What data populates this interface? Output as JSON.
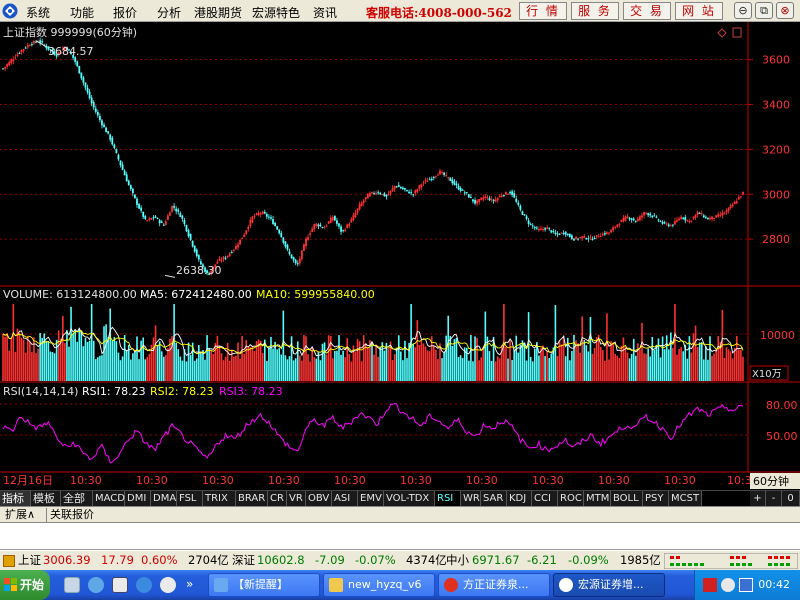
{
  "menu": {
    "items": [
      "系统",
      "功能",
      "报价",
      "分析",
      "港股期货",
      "宏源特色",
      "资讯"
    ],
    "hotline": "客服电话:4008-000-562",
    "link_buttons": [
      "行 情",
      "服 务",
      "交 易",
      "网 站"
    ]
  },
  "main_chart": {
    "title": "上证指数 999999(60分钟)",
    "high_label": "3684.57",
    "low_label": "2638.30",
    "price_axis": [
      "3600",
      "3400",
      "3200",
      "3000",
      "2800"
    ]
  },
  "volume_panel": {
    "label": "VOLUME: 613124800.00",
    "ma5_label": "MA5: 672412480.00",
    "ma10_label": "MA10: 599955840.00",
    "axis_label": "10000",
    "unit_label": "X10万"
  },
  "rsi_panel": {
    "label": "RSI(14,14,14)",
    "rsi1_label": "RSI1: 78.23",
    "rsi2_label": "RSI2: 78.23",
    "rsi3_label": "RSI3: 78.23",
    "axis": [
      "80.00",
      "50.00"
    ]
  },
  "time_axis": {
    "first_label": "12月16日",
    "tick_labels": [
      "10:30",
      "10:30",
      "10:30",
      "10:30",
      "10:30",
      "10:30",
      "10:30",
      "10:30",
      "10:30",
      "10:30",
      "10:3"
    ],
    "period_label": "60分钟"
  },
  "indicator_tabs": [
    "指标",
    "模板",
    "全部",
    "MACD",
    "DMI",
    "DMA",
    "FSL",
    "TRIX",
    "BRAR",
    "CR",
    "VR",
    "OBV",
    "ASI",
    "EMV",
    "VOL-TDX",
    "RSI",
    "WR",
    "SAR",
    "KDJ",
    "CCI",
    "ROC",
    "MTM",
    "BOLL",
    "PSY",
    "MCST"
  ],
  "active_tab": "RSI",
  "tab_controls": [
    "+",
    "-",
    "0"
  ],
  "ext_tabs": [
    "扩展∧",
    "关联报价"
  ],
  "quote_bar": {
    "sh_name": "上证",
    "sh_value": "3006.39",
    "sh_change": "17.79",
    "sh_pct": "0.60%",
    "sh_amount": "2704亿",
    "sz_name": "深证",
    "sz_value": "10602.8",
    "sz_change": "-7.09",
    "sz_pct": "-0.07%",
    "sz_amount": "4374亿",
    "zx_name": "中小",
    "zx_value": "6971.67",
    "zx_change": "-6.21",
    "zx_pct": "-0.09%",
    "zx_amount": "1985亿"
  },
  "taskbar": {
    "start_label": "开始",
    "buttons": [
      "【新提醒】",
      "new_hyzq_v6",
      "方正证券泉...",
      "宏源证券增..."
    ],
    "clock": "00:42"
  },
  "colors": {
    "up": "#ff3232",
    "down": "#54ffff",
    "rsi": "#ff00ff",
    "ma5": "#ffffff",
    "ma10": "#ffff00",
    "grid": "#c00000",
    "axis_text": "#ff3232"
  },
  "chart_data": {
    "type": "line",
    "x_tick_labels": [
      "12月16日",
      "10:30",
      "10:30",
      "10:30",
      "10:30",
      "10:30",
      "10:30",
      "10:30",
      "10:30",
      "10:30",
      "10:30",
      "10:30",
      "10:3"
    ],
    "price_series": {
      "name": "上证指数",
      "ylim": [
        2600,
        3750
      ],
      "y_ticks": [
        2800,
        3000,
        3200,
        3400,
        3600
      ],
      "points": [
        3560,
        3600,
        3640,
        3670,
        3684.57,
        3650,
        3620,
        3660,
        3600,
        3500,
        3400,
        3320,
        3250,
        3150,
        3050,
        2960,
        2880,
        2900,
        2860,
        2950,
        2900,
        2800,
        2700,
        2638.3,
        2700,
        2720,
        2760,
        2820,
        2900,
        2920,
        2890,
        2830,
        2740,
        2680,
        2800,
        2870,
        2850,
        2900,
        2830,
        2880,
        2950,
        3000,
        3010,
        2990,
        3040,
        3020,
        3000,
        3050,
        3070,
        3100,
        3070,
        3030,
        3000,
        2960,
        2990,
        2970,
        3000,
        3010,
        2930,
        2870,
        2840,
        2850,
        2820,
        2830,
        2800,
        2810,
        2800,
        2820,
        2830,
        2870,
        2900,
        2880,
        2920,
        2900,
        2870,
        2860,
        2900,
        2880,
        2920,
        2890,
        2900,
        2920,
        2960,
        3006.39
      ],
      "high": 3684.57,
      "low": 2638.3
    },
    "volume_series": {
      "name": "VOLUME",
      "unit": "X10万",
      "y_ticks": [
        10000
      ],
      "last": 613124800,
      "ma5_last": 672412480,
      "ma10_last": 599955840
    },
    "rsi_series": {
      "name": "RSI(14,14,14)",
      "ylim": [
        20,
        95
      ],
      "y_ticks": [
        50,
        80
      ],
      "points": [
        60,
        55,
        70,
        62,
        58,
        64,
        50,
        40,
        45,
        35,
        30,
        42,
        28,
        33,
        48,
        55,
        45,
        38,
        50,
        60,
        52,
        44,
        36,
        30,
        44,
        52,
        48,
        58,
        66,
        70,
        62,
        50,
        42,
        36,
        58,
        66,
        60,
        68,
        58,
        64,
        72,
        68,
        62,
        76,
        80,
        72,
        66,
        60,
        70,
        64,
        58,
        66,
        56,
        50,
        62,
        58,
        66,
        60,
        48,
        40,
        44,
        38,
        42,
        48,
        40,
        46,
        52,
        44,
        50,
        56,
        62,
        58,
        70,
        64,
        58,
        50,
        62,
        70,
        76,
        70,
        74,
        78,
        74,
        78.23
      ],
      "last": 78.23
    }
  }
}
